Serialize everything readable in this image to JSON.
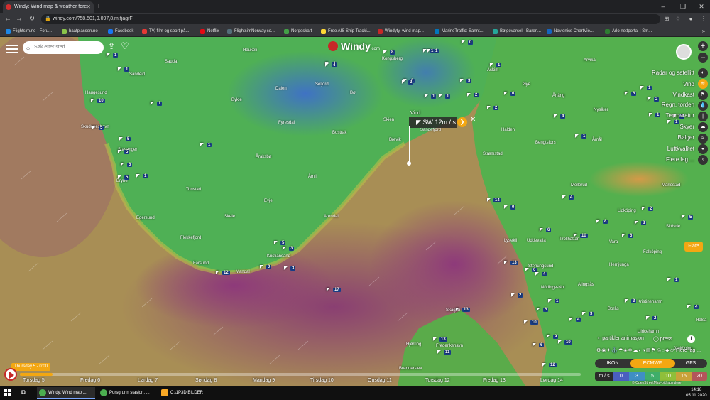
{
  "browser": {
    "tab_title": "Windy: Wind map & weather fore",
    "url": "windy.com/?58.501,9.097,8,m:fjagrF",
    "bookmarks": [
      {
        "label": "Flightsim.no - Foru...",
        "color": "#1e88e5"
      },
      {
        "label": "baatplassen.no",
        "color": "#8bc34a"
      },
      {
        "label": "Facebook",
        "color": "#1877f2"
      },
      {
        "label": "TV, film og sport på...",
        "color": "#e53935"
      },
      {
        "label": "Netflix",
        "color": "#e50914"
      },
      {
        "label": "FlightsimNorway.co...",
        "color": "#546e7a"
      },
      {
        "label": "Norgeskart",
        "color": "#43a047"
      },
      {
        "label": "Free AIS Ship Tracki...",
        "color": "#fdd835"
      },
      {
        "label": "Windyty, wind map...",
        "color": "#c62828"
      },
      {
        "label": "MarineTraffic: Sannt...",
        "color": "#0277bd"
      },
      {
        "label": "Bølgevarsel - Baren...",
        "color": "#26a69a"
      },
      {
        "label": "Navionics ChartVie...",
        "color": "#1565c0"
      },
      {
        "label": "Arlo nettportal | Sm...",
        "color": "#2e7d32"
      }
    ]
  },
  "app": {
    "logo": "Windy",
    "logo_suffix": ".com",
    "search_placeholder": "Søk etter sted ..."
  },
  "picker": {
    "label": "Vind",
    "direction": "SW",
    "value": "12m / s"
  },
  "layers": [
    {
      "label": "Radar og satellitt",
      "active": false
    },
    {
      "label": "Vind",
      "active": true
    },
    {
      "label": "Vindkast",
      "active": false
    },
    {
      "label": "Regn, torden",
      "active": false
    },
    {
      "label": "Temperatur",
      "active": false
    },
    {
      "label": "Skyer",
      "active": false
    },
    {
      "label": "Bølger",
      "active": false
    },
    {
      "label": "Luftkvalitet",
      "active": false
    },
    {
      "label": "Flere lag ...",
      "active": false
    }
  ],
  "controls": {
    "flate": "Flate",
    "particles": "partikler animasjon",
    "pressure": "press",
    "more_layers": "Flere lag ...",
    "models": [
      "IKON",
      "ECMWF",
      "GFS"
    ],
    "active_model": "ECMWF",
    "scale_unit": "m / s",
    "scale_values": [
      "0",
      "3",
      "5",
      "10",
      "15",
      "20",
      "30"
    ],
    "scale_colors": [
      "#4a5fbf",
      "#3f8fc4",
      "#3fae6a",
      "#8fbf3a",
      "#c9a23a",
      "#b3565a",
      "#8e3a7a"
    ],
    "attribution": "© OpenStreetMap-bidragsytere"
  },
  "timeline": {
    "current": "Thursday 5 - 0:00",
    "days": [
      "Torsdag 5",
      "Fredag 6",
      "Lørdag 7",
      "Søndag 8",
      "Mandag 9",
      "Tirsdag 10",
      "Onsdag 11",
      "Torsdag 12",
      "Fredag 13",
      "Lørdag 14"
    ]
  },
  "places": [
    "Sauda",
    "Haukeli",
    "Sandeid",
    "Haugesund",
    "Dalen",
    "Seljord",
    "Bø",
    "Kongsberg",
    "Skudeneshavn",
    "Bykle",
    "Fyresdal",
    "Skien",
    "Bostrak",
    "Bryne",
    "Stavanger",
    "Åraksbø",
    "Brevik",
    "Sandefjord",
    "Åmli",
    "Tonstad",
    "Evje",
    "Arendal",
    "Skeie",
    "Egersund",
    "Flekkefjord",
    "Kristiansand",
    "Farsund",
    "Mandal",
    "Askim",
    "Øye",
    "Arvika",
    "Halden",
    "Strømstad",
    "Bengtsfors",
    "Årjäng",
    "Nysäter",
    "Åmål",
    "Mellerud",
    "Lidköping",
    "Vara",
    "Trollhättan",
    "Uddevalla",
    "Herrljunga",
    "Alingsås",
    "Borås",
    "Falköping",
    "Stenungsund",
    "Lysekil",
    "Nödinge-Nol",
    "Skagen",
    "Hjørring",
    "Frederikshavn",
    "Brønderslev",
    "Kristinehamn",
    "Mariestad",
    "Skövde",
    "Halsa",
    "Jönköping",
    "Ulricehamn"
  ],
  "wind_labels": [
    "1",
    "1",
    "10",
    "5",
    "5",
    "1",
    "8",
    "4",
    "1",
    "0",
    "1",
    "2",
    "3",
    "1",
    "1",
    "2",
    "6",
    "1",
    "2",
    "4",
    "1",
    "2",
    "1",
    "6",
    "1",
    "4",
    "1",
    "5",
    "6",
    "1",
    "5",
    "1",
    "2",
    "3",
    "0",
    "3",
    "5",
    "14",
    "0",
    "13",
    "12",
    "17",
    "4",
    "6",
    "10",
    "8",
    "6",
    "2",
    "8",
    "5",
    "6",
    "2",
    "4",
    "3",
    "13",
    "4",
    "1",
    "6",
    "12",
    "13",
    "11",
    "10",
    "9",
    "10",
    "6",
    "3",
    "2",
    "1",
    "4",
    "4"
  ],
  "taskbar": {
    "items": [
      {
        "label": "Windy: Wind map ...",
        "color": "#4caf50",
        "active": true
      },
      {
        "label": "Porsgrunn stasjon, ...",
        "color": "#4caf50",
        "active": false
      },
      {
        "label": "C:\\1P3D BILDER",
        "color": "#f9a825",
        "active": false
      }
    ],
    "time": "14:18",
    "date": "05.11.2020"
  }
}
